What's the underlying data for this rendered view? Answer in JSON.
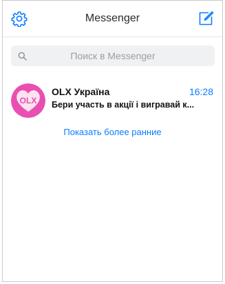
{
  "header": {
    "title": "Messenger",
    "settings_icon": "gear-icon",
    "compose_icon": "compose-icon"
  },
  "search": {
    "placeholder": "Поиск в Messenger",
    "icon": "search-icon"
  },
  "conversations": [
    {
      "name": "OLX Україна",
      "time": "16:28",
      "preview": "Бери участь в акції і вигравай к...",
      "avatar_text": "OLX"
    }
  ],
  "show_earlier": "Показать более ранние",
  "colors": {
    "accent": "#0a7cff",
    "avatar_bg": "#e94fb0",
    "avatar_heart": "#fbe3ef"
  }
}
